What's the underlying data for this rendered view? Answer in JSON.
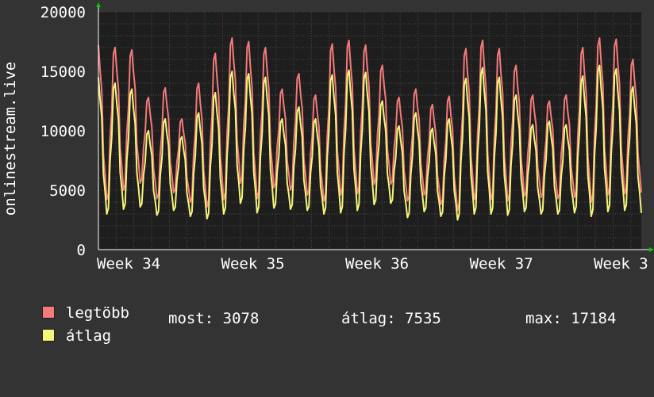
{
  "chart_data": {
    "type": "line",
    "ylabel": "onlinestream.live",
    "ylim": [
      0,
      20000
    ],
    "yticks": [
      "20000",
      "15000",
      "10000",
      "5000",
      "0"
    ],
    "xticks": [
      "Week 34",
      "Week 35",
      "Week 36",
      "Week 37",
      "Week 3"
    ],
    "grid": true,
    "series": [
      {
        "name": "legtöbb",
        "color": "#F57A7A",
        "values": [
          17200,
          4200,
          17000,
          5000,
          16800,
          5600,
          12800,
          4300,
          13600,
          4800,
          11000,
          4000,
          14000,
          3600,
          16500,
          4200,
          17800,
          5600,
          17500,
          4300,
          17000,
          5200,
          13500,
          5000,
          14800,
          4600,
          13000,
          4100,
          17300,
          4600,
          17600,
          4700,
          17200,
          5500,
          15500,
          5500,
          12800,
          4100,
          13500,
          4600,
          12200,
          3800,
          12900,
          3300,
          16900,
          4200,
          17600,
          4200,
          16900,
          4100,
          15500,
          4500,
          13000,
          4400,
          12500,
          4300,
          13000,
          4400,
          17000,
          4000,
          17800,
          4600,
          17700,
          4700,
          16000,
          4800
        ]
      },
      {
        "name": "átlag",
        "color": "#F5F57A",
        "values": [
          14500,
          3000,
          14000,
          3400,
          13500,
          3600,
          10000,
          2900,
          11000,
          3300,
          9500,
          2800,
          11500,
          2600,
          13200,
          3000,
          15000,
          3900,
          14800,
          3100,
          14500,
          3500,
          11000,
          3400,
          12000,
          3300,
          11000,
          3000,
          14700,
          3100,
          15100,
          3300,
          14900,
          3800,
          12500,
          3900,
          10400,
          2700,
          11500,
          3200,
          10200,
          2800,
          11000,
          2500,
          14400,
          3000,
          15300,
          3000,
          14500,
          2900,
          13000,
          3200,
          10500,
          3000,
          10800,
          3000,
          10500,
          3100,
          14600,
          2800,
          15500,
          3200,
          15200,
          3300,
          13700,
          3078
        ]
      }
    ]
  },
  "legend": {
    "max_label": "legtöbb",
    "avg_label": "átlag",
    "now_text": "most: 3078",
    "avg_text": "átlag: 7535",
    "max_text": "max: 17184"
  },
  "colors": {
    "background": "#333333",
    "plot_background": "#1e1e1e",
    "grid": "#4a4a4a",
    "arrow": "#00cc00"
  }
}
